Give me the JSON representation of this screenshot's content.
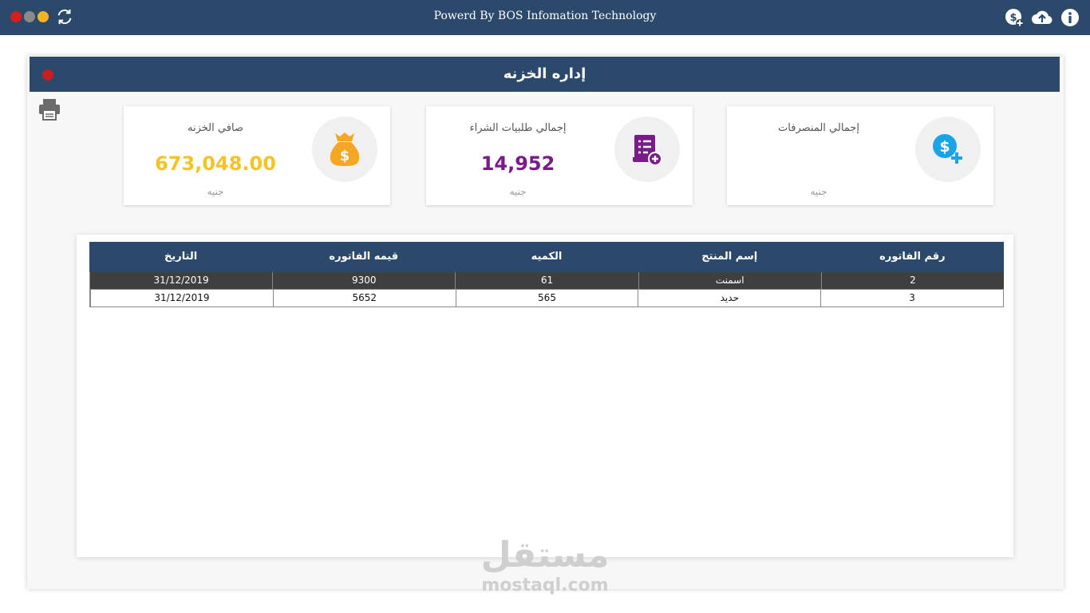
{
  "window": {
    "title": "Powerd By BOS Infomation Technology",
    "colors": {
      "close": "#d81e1e",
      "minimize": "#8a8a8a",
      "maximize": "#f2b51d",
      "bar": "#2b4a6b"
    }
  },
  "toolbar": {
    "icons": [
      "refresh-icon",
      "add-money-icon",
      "cloud-upload-icon",
      "info-icon"
    ]
  },
  "panel": {
    "title": "إداره الخزنه"
  },
  "cards": [
    {
      "label": "صافي الخزنه",
      "value": "673,048.00",
      "unit": "جنيه",
      "icon": "money-bag-icon",
      "color": "#f5c324"
    },
    {
      "label": "إجمالي طلبيات الشراء",
      "value": "14,952",
      "unit": "جنيه",
      "icon": "purchase-order-icon",
      "color": "#7a1b8a"
    },
    {
      "label": "إجمالي المنصرفات",
      "value": "",
      "unit": "جنيه",
      "icon": "dollar-add-icon",
      "color": "#1aa3e8"
    }
  ],
  "table": {
    "columns": [
      "رقم الفاتوره",
      "إسم المنتج",
      "الكميه",
      "قيمه الفاتوره",
      "التاريخ"
    ],
    "rows": [
      [
        "2",
        "اسمنت",
        "61",
        "9300",
        "31/12/2019"
      ],
      [
        "3",
        "حديد",
        "565",
        "5652",
        "31/12/2019"
      ]
    ]
  },
  "watermark": {
    "arabic": "مستقل",
    "latin": "mostaql.com"
  }
}
